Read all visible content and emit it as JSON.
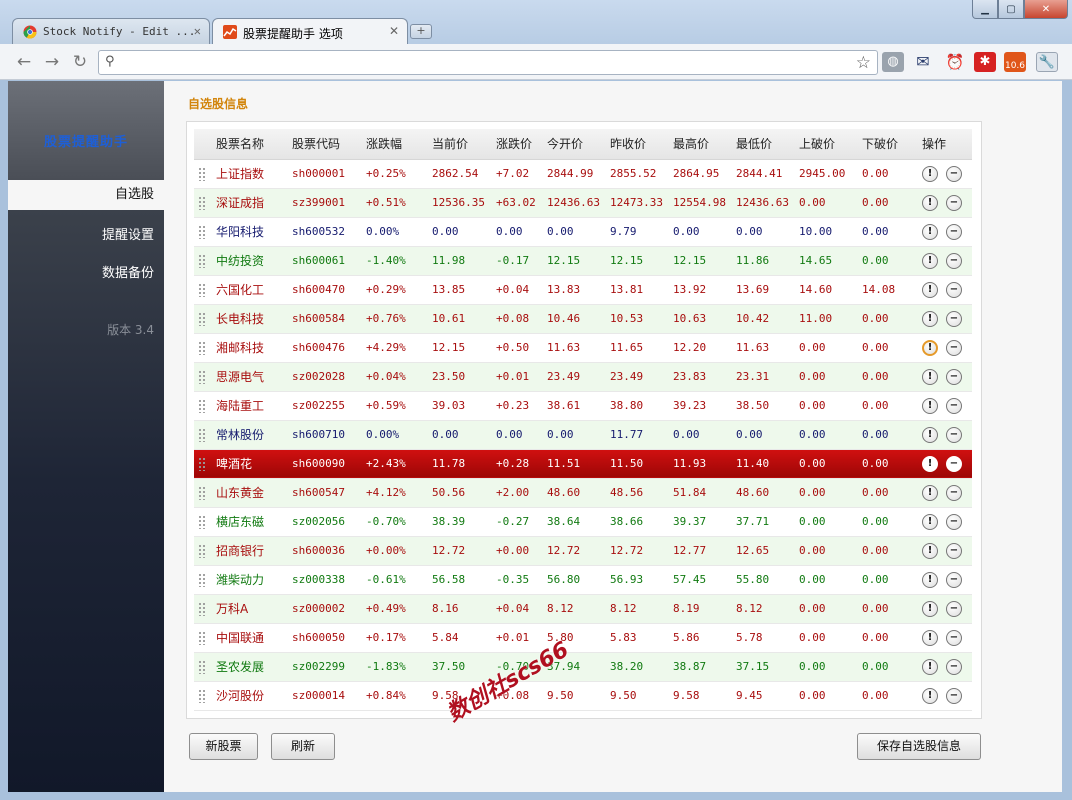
{
  "browser": {
    "tabs": [
      {
        "label": "Stock Notify - Edit ..."
      },
      {
        "label": "股票提醒助手 选项"
      }
    ],
    "new_tab_label": "+",
    "omnibox": {
      "value": "",
      "placeholder": ""
    },
    "extension_badge": "10.6"
  },
  "sidebar": {
    "title": "股票提醒助手",
    "items": [
      {
        "label": "自选股",
        "active": true
      },
      {
        "label": "提醒设置"
      },
      {
        "label": "数据备份"
      }
    ],
    "version": "版本 3.4"
  },
  "main": {
    "section_title": "自选股信息",
    "columns": [
      "股票名称",
      "股票代码",
      "涨跌幅",
      "当前价",
      "涨跌价",
      "今开价",
      "昨收价",
      "最高价",
      "最低价",
      "上破价",
      "下破价",
      "操作"
    ],
    "rows": [
      {
        "name": "上证指数",
        "code": "sh000001",
        "pct": "+0.25%",
        "cur": "2862.54",
        "chg": "+7.02",
        "open": "2844.99",
        "prev": "2855.52",
        "high": "2864.95",
        "low": "2844.41",
        "up": "2945.00",
        "down": "0.00",
        "trend": "up"
      },
      {
        "name": "深证成指",
        "code": "sz399001",
        "pct": "+0.51%",
        "cur": "12536.35",
        "chg": "+63.02",
        "open": "12436.63",
        "prev": "12473.33",
        "high": "12554.98",
        "low": "12436.63",
        "up": "0.00",
        "down": "0.00",
        "trend": "up"
      },
      {
        "name": "华阳科技",
        "code": "sh600532",
        "pct": "0.00%",
        "cur": "0.00",
        "chg": "0.00",
        "open": "0.00",
        "prev": "9.79",
        "high": "0.00",
        "low": "0.00",
        "up": "10.00",
        "down": "0.00",
        "trend": "flat"
      },
      {
        "name": "中纺投资",
        "code": "sh600061",
        "pct": "-1.40%",
        "cur": "11.98",
        "chg": "-0.17",
        "open": "12.15",
        "prev": "12.15",
        "high": "12.15",
        "low": "11.86",
        "up": "14.65",
        "down": "0.00",
        "trend": "dn"
      },
      {
        "name": "六国化工",
        "code": "sh600470",
        "pct": "+0.29%",
        "cur": "13.85",
        "chg": "+0.04",
        "open": "13.83",
        "prev": "13.81",
        "high": "13.92",
        "low": "13.69",
        "up": "14.60",
        "down": "14.08",
        "trend": "up"
      },
      {
        "name": "长电科技",
        "code": "sh600584",
        "pct": "+0.76%",
        "cur": "10.61",
        "chg": "+0.08",
        "open": "10.46",
        "prev": "10.53",
        "high": "10.63",
        "low": "10.42",
        "up": "11.00",
        "down": "0.00",
        "trend": "up"
      },
      {
        "name": "湘邮科技",
        "code": "sh600476",
        "pct": "+4.29%",
        "cur": "12.15",
        "chg": "+0.50",
        "open": "11.63",
        "prev": "11.65",
        "high": "12.20",
        "low": "11.63",
        "up": "0.00",
        "down": "0.00",
        "trend": "up",
        "alert_highlight": true
      },
      {
        "name": "思源电气",
        "code": "sz002028",
        "pct": "+0.04%",
        "cur": "23.50",
        "chg": "+0.01",
        "open": "23.49",
        "prev": "23.49",
        "high": "23.83",
        "low": "23.31",
        "up": "0.00",
        "down": "0.00",
        "trend": "up"
      },
      {
        "name": "海陆重工",
        "code": "sz002255",
        "pct": "+0.59%",
        "cur": "39.03",
        "chg": "+0.23",
        "open": "38.61",
        "prev": "38.80",
        "high": "39.23",
        "low": "38.50",
        "up": "0.00",
        "down": "0.00",
        "trend": "up"
      },
      {
        "name": "常林股份",
        "code": "sh600710",
        "pct": "0.00%",
        "cur": "0.00",
        "chg": "0.00",
        "open": "0.00",
        "prev": "11.77",
        "high": "0.00",
        "low": "0.00",
        "up": "0.00",
        "down": "0.00",
        "trend": "flat"
      },
      {
        "name": "啤酒花",
        "code": "sh600090",
        "pct": "+2.43%",
        "cur": "11.78",
        "chg": "+0.28",
        "open": "11.51",
        "prev": "11.50",
        "high": "11.93",
        "low": "11.40",
        "up": "0.00",
        "down": "0.00",
        "trend": "up",
        "selected": true
      },
      {
        "name": "山东黄金",
        "code": "sh600547",
        "pct": "+4.12%",
        "cur": "50.56",
        "chg": "+2.00",
        "open": "48.60",
        "prev": "48.56",
        "high": "51.84",
        "low": "48.60",
        "up": "0.00",
        "down": "0.00",
        "trend": "up"
      },
      {
        "name": "横店东磁",
        "code": "sz002056",
        "pct": "-0.70%",
        "cur": "38.39",
        "chg": "-0.27",
        "open": "38.64",
        "prev": "38.66",
        "high": "39.37",
        "low": "37.71",
        "up": "0.00",
        "down": "0.00",
        "trend": "dn"
      },
      {
        "name": "招商银行",
        "code": "sh600036",
        "pct": "+0.00%",
        "cur": "12.72",
        "chg": "+0.00",
        "open": "12.72",
        "prev": "12.72",
        "high": "12.77",
        "low": "12.65",
        "up": "0.00",
        "down": "0.00",
        "trend": "up"
      },
      {
        "name": "潍柴动力",
        "code": "sz000338",
        "pct": "-0.61%",
        "cur": "56.58",
        "chg": "-0.35",
        "open": "56.80",
        "prev": "56.93",
        "high": "57.45",
        "low": "55.80",
        "up": "0.00",
        "down": "0.00",
        "trend": "dn"
      },
      {
        "name": "万科A",
        "code": "sz000002",
        "pct": "+0.49%",
        "cur": "8.16",
        "chg": "+0.04",
        "open": "8.12",
        "prev": "8.12",
        "high": "8.19",
        "low": "8.12",
        "up": "0.00",
        "down": "0.00",
        "trend": "up"
      },
      {
        "name": "中国联通",
        "code": "sh600050",
        "pct": "+0.17%",
        "cur": "5.84",
        "chg": "+0.01",
        "open": "5.80",
        "prev": "5.83",
        "high": "5.86",
        "low": "5.78",
        "up": "0.00",
        "down": "0.00",
        "trend": "up"
      },
      {
        "name": "圣农发展",
        "code": "sz002299",
        "pct": "-1.83%",
        "cur": "37.50",
        "chg": "-0.70",
        "open": "37.94",
        "prev": "38.20",
        "high": "38.87",
        "low": "37.15",
        "up": "0.00",
        "down": "0.00",
        "trend": "dn"
      },
      {
        "name": "沙河股份",
        "code": "sz000014",
        "pct": "+0.84%",
        "cur": "9.58",
        "chg": "+0.08",
        "open": "9.50",
        "prev": "9.50",
        "high": "9.58",
        "low": "9.45",
        "up": "0.00",
        "down": "0.00",
        "trend": "up"
      }
    ],
    "op_alert_symbol": "!",
    "op_remove_symbol": "−",
    "buttons": {
      "new": "新股票",
      "refresh": "刷新",
      "save": "保存自选股信息"
    }
  },
  "watermark": "数创社scs66",
  "colors": {
    "up": "#a80e0e",
    "down": "#117a11",
    "flat": "#151a6e",
    "selected": "#c00a0a",
    "section_title": "#d2850c"
  },
  "icons": [
    "back-arrow-icon",
    "forward-arrow-icon",
    "reload-icon",
    "search-icon",
    "bookmark-star-icon",
    "globe-icon",
    "gmail-icon",
    "alarm-clock-icon",
    "star-extension-icon",
    "stock-chart-icon",
    "wrench-icon",
    "drag-handle-icon",
    "alert-icon",
    "remove-icon"
  ]
}
